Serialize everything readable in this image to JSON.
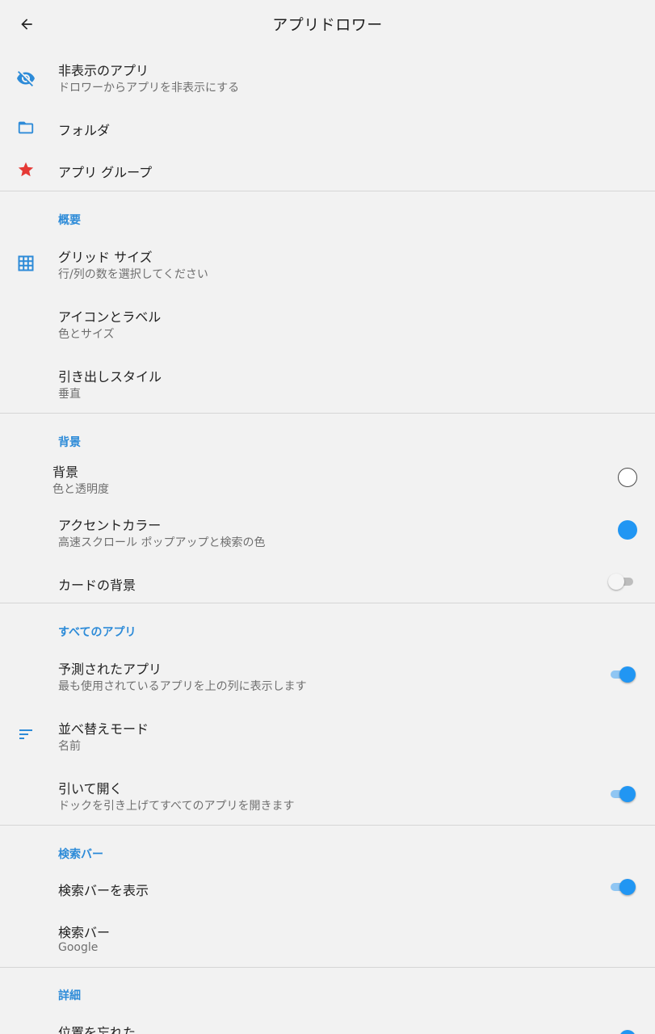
{
  "colors": {
    "accent": "#2196f3",
    "section_header": "#2d8bd8",
    "star": "#e53935",
    "background": "#f2f2f2"
  },
  "appbar": {
    "title": "アプリドロワー",
    "back_icon": "arrow-back-icon"
  },
  "top_items": [
    {
      "icon": "visibility-off-icon",
      "title": "非表示のアプリ",
      "summary": "ドロワーからアプリを非表示にする"
    },
    {
      "icon": "folder-icon",
      "title": "フォルダ"
    },
    {
      "icon": "star-icon",
      "title": "アプリ グループ"
    }
  ],
  "sections": {
    "overview": {
      "header": "概要",
      "grid_size": {
        "icon": "grid-icon",
        "title": "グリッド サイズ",
        "summary": "行/列の数を選択してください"
      },
      "icons_labels": {
        "title": "アイコンとラベル",
        "summary": "色とサイズ"
      },
      "drawer_style": {
        "title": "引き出しスタイル",
        "summary": "垂直"
      }
    },
    "background": {
      "header": "背景",
      "background": {
        "title": "背景",
        "summary": "色と透明度",
        "color": "#ffffff"
      },
      "accent": {
        "title": "アクセントカラー",
        "summary": "高速スクロール ポップアップと検索の色",
        "color": "#2196f3"
      },
      "card_bg": {
        "title": "カードの背景",
        "enabled": false
      }
    },
    "all_apps": {
      "header": "すべてのアプリ",
      "predicted": {
        "title": "予測されたアプリ",
        "summary": "最も使用されているアプリを上の列に表示します",
        "enabled": true
      },
      "sort_mode": {
        "icon": "sort-icon",
        "title": "並べ替えモード",
        "summary": "名前"
      },
      "pull_open": {
        "title": "引いて開く",
        "summary": "ドックを引き上げてすべてのアプリを開きます",
        "enabled": true
      }
    },
    "search_bar": {
      "header": "検索バー",
      "show": {
        "title": "検索バーを表示",
        "enabled": true
      },
      "provider": {
        "title": "検索バー",
        "summary": "Google"
      }
    },
    "details": {
      "header": "詳細",
      "remember_position": {
        "title": "位置を忘れた",
        "enabled": true
      }
    }
  }
}
